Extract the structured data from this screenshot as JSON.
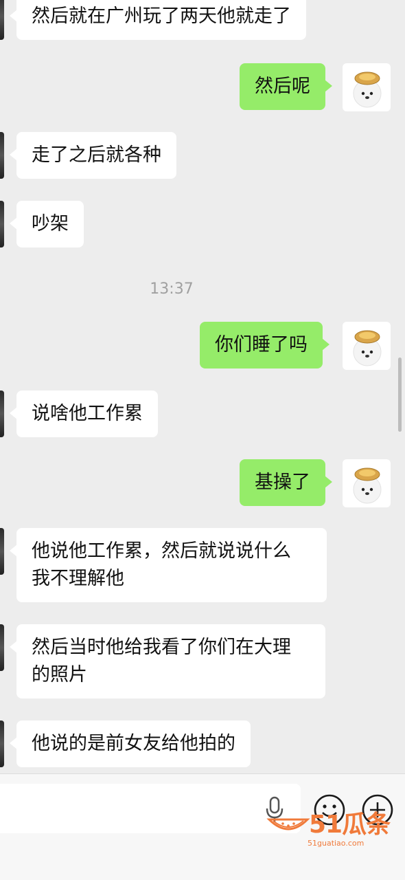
{
  "messages": [
    {
      "side": "left",
      "text": "然后就在广州玩了两天他就走了"
    },
    {
      "side": "right",
      "text": "然后呢"
    },
    {
      "side": "left",
      "text": "走了之后就各种"
    },
    {
      "side": "left",
      "text": "吵架"
    },
    {
      "side": "right",
      "text": "你们睡了吗"
    },
    {
      "side": "left",
      "text": "说啥他工作累"
    },
    {
      "side": "right",
      "text": "基操了"
    },
    {
      "side": "left",
      "lines": [
        "他说他工作累，然后就说说什么",
        "我不理解他"
      ]
    },
    {
      "side": "left",
      "lines": [
        "然后当时他给我看了你们在大理",
        "的照片"
      ]
    },
    {
      "side": "left",
      "text": "他说的是前女友给他拍的"
    }
  ],
  "timestamp": "13:37",
  "input_bar": {
    "value": "",
    "icons": [
      "voice-icon",
      "emoji-icon",
      "plus-icon"
    ]
  },
  "watermark": {
    "brand": "51瓜条",
    "url": "51guatiao.com"
  },
  "colors": {
    "background": "#ededed",
    "bubble_self": "#95ec69",
    "bubble_other": "#ffffff"
  }
}
